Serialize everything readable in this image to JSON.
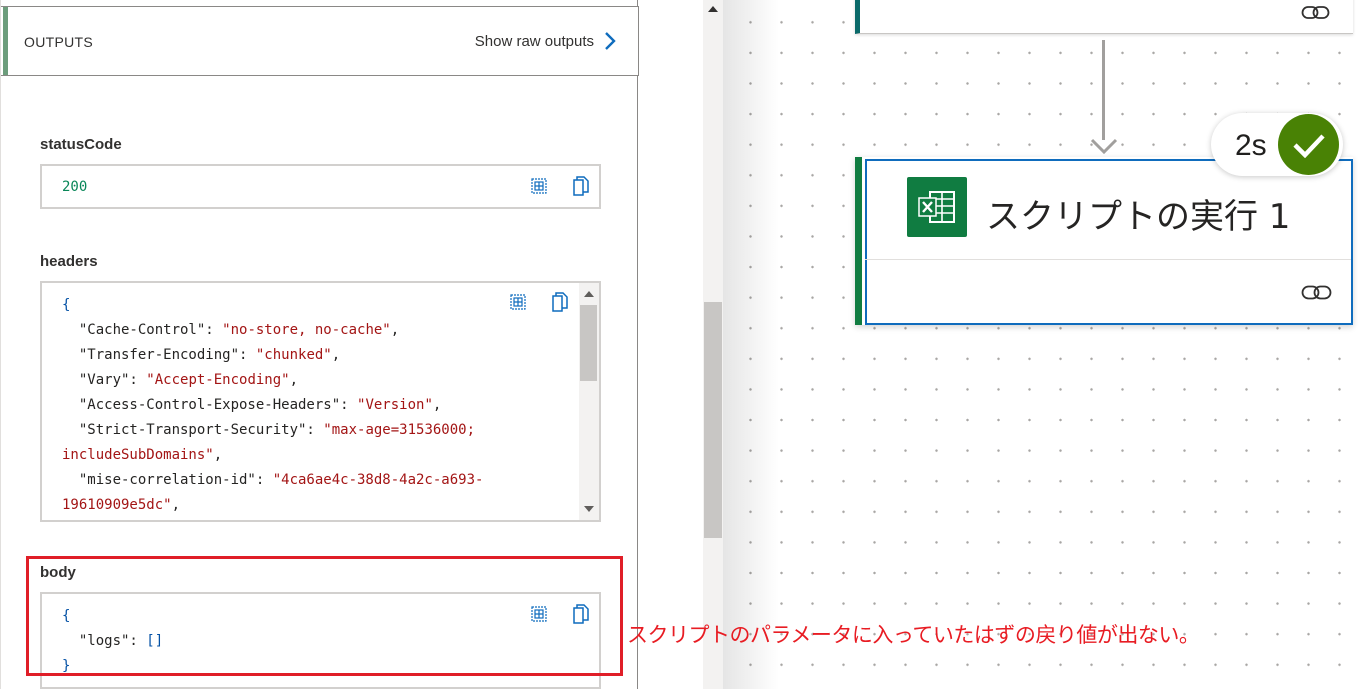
{
  "outputs_panel": {
    "title": "OUTPUTS",
    "show_raw_label": "Show raw outputs",
    "status_code": {
      "label": "statusCode",
      "value": "200"
    },
    "headers": {
      "label": "headers",
      "lines": [
        [
          {
            "t": "{",
            "c": "punc"
          }
        ],
        [
          {
            "t": "  \"Cache-Control\": ",
            "c": "key"
          },
          {
            "t": "\"no-store, no-cache\"",
            "c": "str"
          },
          {
            "t": ",",
            "c": "plain"
          }
        ],
        [
          {
            "t": "  \"Transfer-Encoding\": ",
            "c": "key"
          },
          {
            "t": "\"chunked\"",
            "c": "str"
          },
          {
            "t": ",",
            "c": "plain"
          }
        ],
        [
          {
            "t": "  \"Vary\": ",
            "c": "key"
          },
          {
            "t": "\"Accept-Encoding\"",
            "c": "str"
          },
          {
            "t": ",",
            "c": "plain"
          }
        ],
        [
          {
            "t": "  \"Access-Control-Expose-Headers\": ",
            "c": "key"
          },
          {
            "t": "\"Version\"",
            "c": "str"
          },
          {
            "t": ",",
            "c": "plain"
          }
        ],
        [
          {
            "t": "  \"Strict-Transport-Security\": ",
            "c": "key"
          },
          {
            "t": "\"max-age=31536000;",
            "c": "str"
          }
        ],
        [
          {
            "t": "includeSubDomains\"",
            "c": "str"
          },
          {
            "t": ",",
            "c": "plain"
          }
        ],
        [
          {
            "t": "  \"mise-correlation-id\": ",
            "c": "key"
          },
          {
            "t": "\"4ca6ae4c-38d8-4a2c-a693-",
            "c": "str"
          }
        ],
        [
          {
            "t": "19610909e5dc\"",
            "c": "str"
          },
          {
            "t": ",",
            "c": "plain"
          }
        ]
      ]
    },
    "body": {
      "label": "body",
      "lines": [
        [
          {
            "t": "{",
            "c": "punc"
          }
        ],
        [
          {
            "t": "  \"logs\": ",
            "c": "key"
          },
          {
            "t": "[]",
            "c": "punc"
          }
        ],
        [
          {
            "t": "}",
            "c": "punc"
          }
        ]
      ]
    },
    "icons": [
      "table-view-icon",
      "copy-icon",
      "chevron-right-icon"
    ]
  },
  "canvas": {
    "action_card": {
      "title": "スクリプトの実行 1",
      "icon": "excel-icon",
      "duration": "2s",
      "status": "succeeded"
    }
  },
  "annotation": {
    "note": "スクリプトのパラメータに入っていたはずの戻り値が出ない。",
    "color": "#e81c23"
  },
  "colors": {
    "excel_green": "#107c41",
    "success_green": "#498205",
    "selection_blue": "#0f6cbd",
    "string_red": "#a31515",
    "number_green": "#098658"
  }
}
